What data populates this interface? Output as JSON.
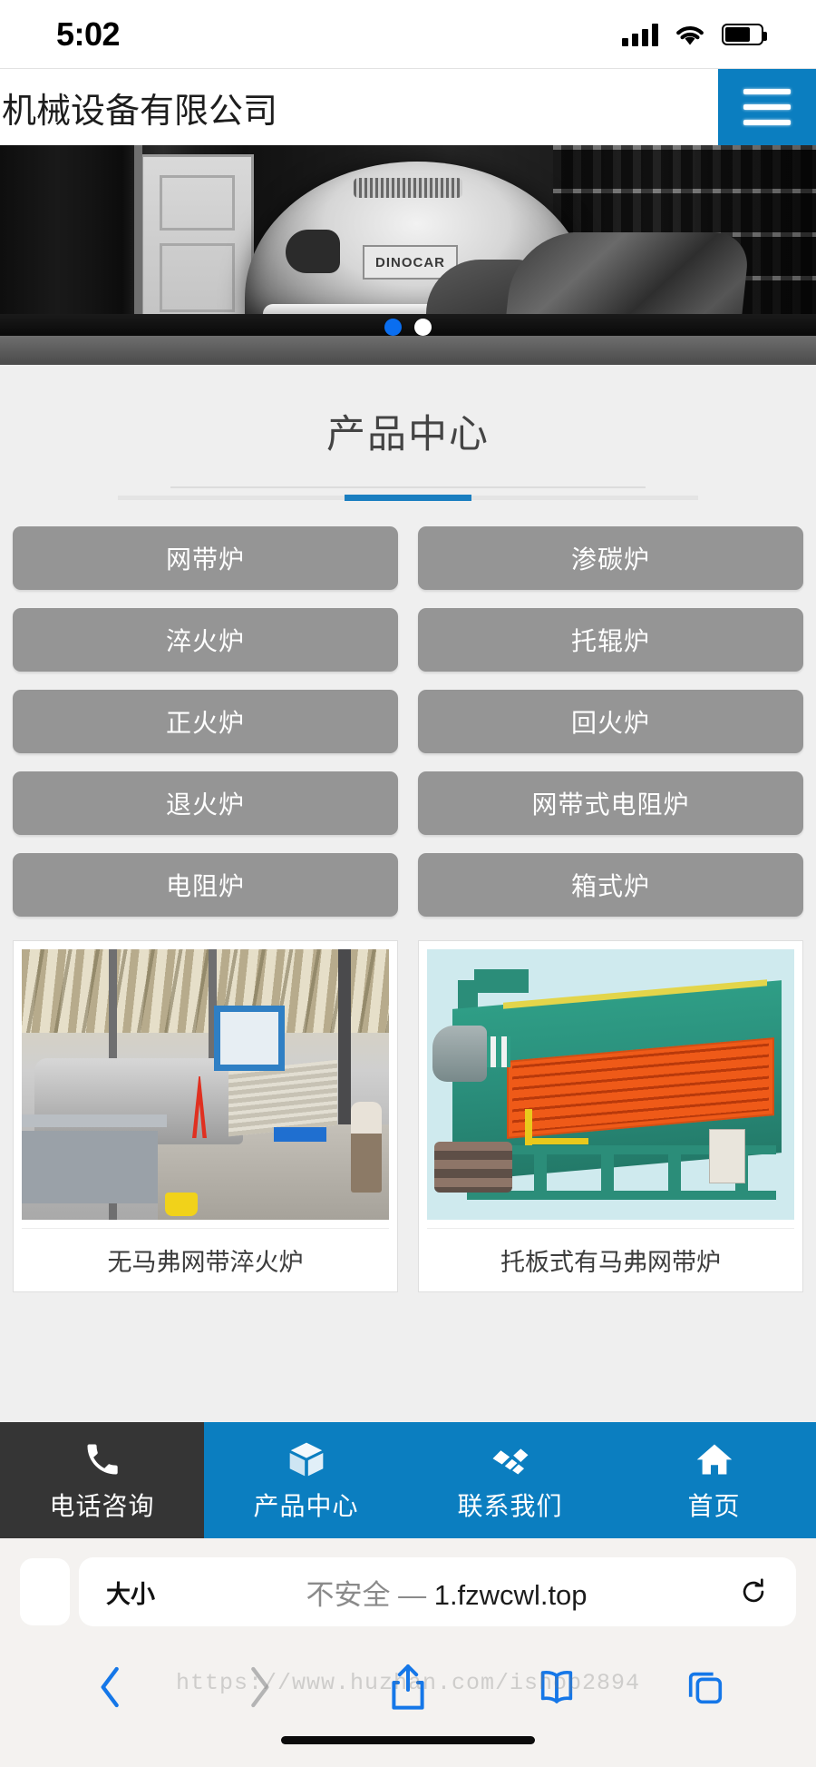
{
  "status_bar": {
    "time": "5:02",
    "signal_icon": "cellular-signal-icon",
    "wifi_icon": "wifi-icon",
    "battery_icon": "battery-icon",
    "battery_level": 70
  },
  "site_header": {
    "title": "机械设备有限公司",
    "menu_icon": "hamburger-menu-icon",
    "accent_color": "#0b7ec0"
  },
  "banner": {
    "alt": "黑白车间汽车维修图片",
    "plate_text": "DINOCAR",
    "dots": [
      {
        "active": true
      },
      {
        "active": false
      }
    ]
  },
  "products_section": {
    "title": "产品中心",
    "accent_color": "#1a7ec0",
    "categories": [
      {
        "label": "网带炉"
      },
      {
        "label": "渗碳炉"
      },
      {
        "label": "淬火炉"
      },
      {
        "label": "托辊炉"
      },
      {
        "label": "正火炉"
      },
      {
        "label": "回火炉"
      },
      {
        "label": "退火炉"
      },
      {
        "label": "网带式电阻炉"
      },
      {
        "label": "电阻炉"
      },
      {
        "label": "箱式炉"
      }
    ],
    "category_color": "#959595",
    "cards": [
      {
        "caption": "无马弗网带淬火炉",
        "image_alt": "车间内的网带淬火炉设备照片"
      },
      {
        "caption": "托板式有马弗网带炉",
        "image_alt": "绿色橙色托板式有马弗网带炉设备照片"
      }
    ]
  },
  "bottom_nav": [
    {
      "label": "电话咨询",
      "icon": "phone-icon",
      "style": "dark"
    },
    {
      "label": "产品中心",
      "icon": "box-icon",
      "style": "blue"
    },
    {
      "label": "联系我们",
      "icon": "handshake-icon",
      "style": "blue"
    },
    {
      "label": "首页",
      "icon": "home-icon",
      "style": "blue"
    }
  ],
  "safari": {
    "aa_label": "大小",
    "security_label": "不安全",
    "separator": "—",
    "domain": "1.fzwcwl.top",
    "reload_icon": "reload-icon",
    "toolbar": [
      {
        "name": "back-button",
        "icon": "chevron-left-icon",
        "enabled": true
      },
      {
        "name": "forward-button",
        "icon": "chevron-right-icon",
        "enabled": false
      },
      {
        "name": "share-button",
        "icon": "share-icon",
        "enabled": true
      },
      {
        "name": "bookmarks-button",
        "icon": "book-icon",
        "enabled": true
      },
      {
        "name": "tabs-button",
        "icon": "tabs-icon",
        "enabled": true
      }
    ]
  },
  "watermark": {
    "text": "https://www.huzhan.com/ishop2894"
  }
}
